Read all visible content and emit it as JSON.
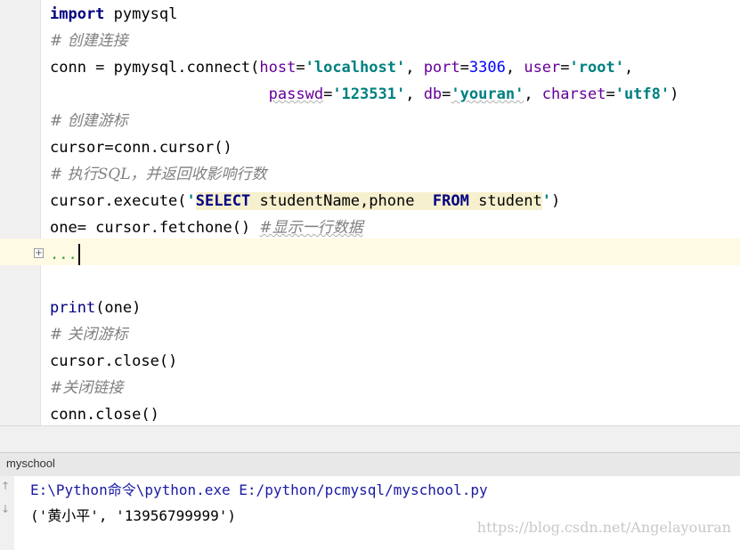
{
  "editor": {
    "lines": {
      "l1": {
        "kw": "import",
        "rest": " pymysql"
      },
      "l2": {
        "comment": "# 创建连接"
      },
      "l3": {
        "prefix": "conn = pymysql.connect(",
        "p1": "host",
        "eq1": "=",
        "v1": "'localhost'",
        "sep1": ", ",
        "p2": "port",
        "eq2": "=",
        "v2": "3306",
        "sep2": ", ",
        "p3": "user",
        "eq3": "=",
        "v3": "'root'",
        "sep3": ","
      },
      "l4": {
        "indent": "                        ",
        "p1": "passwd",
        "eq1": "=",
        "v1": "'123531'",
        "sep1": ", ",
        "p2": "db",
        "eq2": "=",
        "v2": "'youran'",
        "sep2": ", ",
        "p3": "charset",
        "eq3": "=",
        "v3": "'utf8'",
        "close": ")"
      },
      "l5": {
        "comment": "# 创建游标"
      },
      "l6": {
        "text": "cursor=conn.cursor()"
      },
      "l7": {
        "comment": "# 执行SQL，并返回收影响行数"
      },
      "l8": {
        "prefix": "cursor.execute(",
        "q_open": "'",
        "sql_kw1": "SELECT",
        "sql_mid": " studentName,phone  ",
        "sql_kw2": "FROM",
        "sql_tail": " student",
        "q_close": "'",
        "close": ")"
      },
      "l9": {
        "text": "one= cursor.fetchone() ",
        "comment": "#显示一行数据"
      },
      "l10": {
        "fold": "..."
      },
      "l12": {
        "builtin": "print",
        "rest": "(one)"
      },
      "l13": {
        "comment": "# 关闭游标"
      },
      "l14": {
        "text": "cursor.close()"
      },
      "l15": {
        "comment": "#关闭链接"
      },
      "l16": {
        "text": "conn.close()"
      }
    },
    "fold_icon": "+"
  },
  "run": {
    "tab_label": "myschool",
    "up_icon": "↑",
    "down_icon": "↓",
    "command": "E:\\Python命令\\python.exe E:/python/pcmysql/myschool.py",
    "output": "('黄小平', '13956799999')",
    "watermark": "https://blog.csdn.net/Angelayouran"
  }
}
